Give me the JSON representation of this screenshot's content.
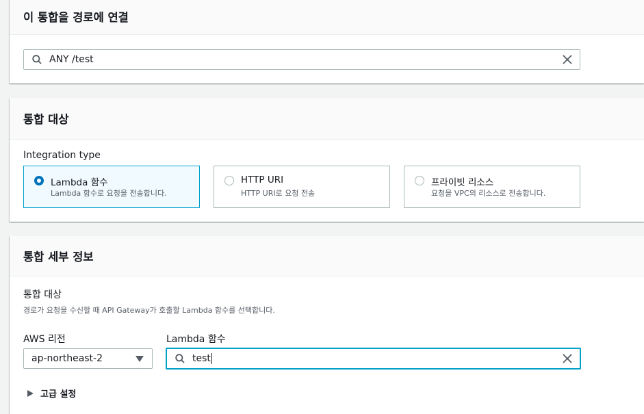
{
  "route_section": {
    "title": "이 통합을 경로에 연결",
    "search": {
      "value": "ANY /test",
      "icon": "search-icon",
      "clear_icon": "close-icon"
    }
  },
  "target_section": {
    "title": "통합 대상",
    "integration_type_label": "Integration type",
    "options": [
      {
        "label": "Lambda 함수",
        "description": "Lambda 함수로 요청을 전송합니다.",
        "selected": true
      },
      {
        "label": "HTTP URI",
        "description": "HTTP URI로 요청 전송",
        "selected": false
      },
      {
        "label": "프라이빗 리소스",
        "description": "요청을 VPC의 리소스로 전송합니다.",
        "selected": false
      }
    ]
  },
  "details_section": {
    "title": "통합 세부 정보",
    "target_label": "통합 대상",
    "target_description": "경로가 요청을 수신할 때 API Gateway가 호출할 Lambda 함수를 선택합니다.",
    "region": {
      "label": "AWS 리전",
      "value": "ap-northeast-2"
    },
    "lambda": {
      "label": "Lambda 함수",
      "value": "test"
    },
    "advanced_label": "고급 설정"
  },
  "colors": {
    "accent": "#0073bb",
    "focus": "#00a1c9",
    "border": "#aab7b8",
    "background": "#f2f3f3"
  }
}
